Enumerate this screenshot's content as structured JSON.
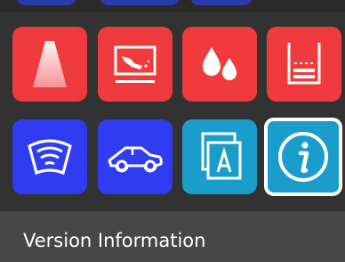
{
  "tiles": [
    {
      "row": 1,
      "icon": "road-light-beam-icon",
      "color": "red"
    },
    {
      "row": 1,
      "icon": "car-on-screen-icon",
      "color": "red"
    },
    {
      "row": 1,
      "icon": "water-drops-icon",
      "color": "red"
    },
    {
      "row": 1,
      "icon": "fluid-container-icon",
      "color": "red"
    },
    {
      "row": 2,
      "icon": "windshield-wifi-icon",
      "color": "blue"
    },
    {
      "row": 2,
      "icon": "car-side-icon",
      "color": "blue"
    },
    {
      "row": 2,
      "icon": "layers-a-icon",
      "color": "teal"
    },
    {
      "row": 2,
      "icon": "info-icon",
      "color": "teal",
      "selected": true
    }
  ],
  "colors": {
    "red": "#ef3b3d",
    "blue": "#2f3cf2",
    "teal": "#1a9dcb",
    "background": "#323232",
    "footer": "#474747"
  },
  "footer": {
    "label": "Version Information"
  }
}
